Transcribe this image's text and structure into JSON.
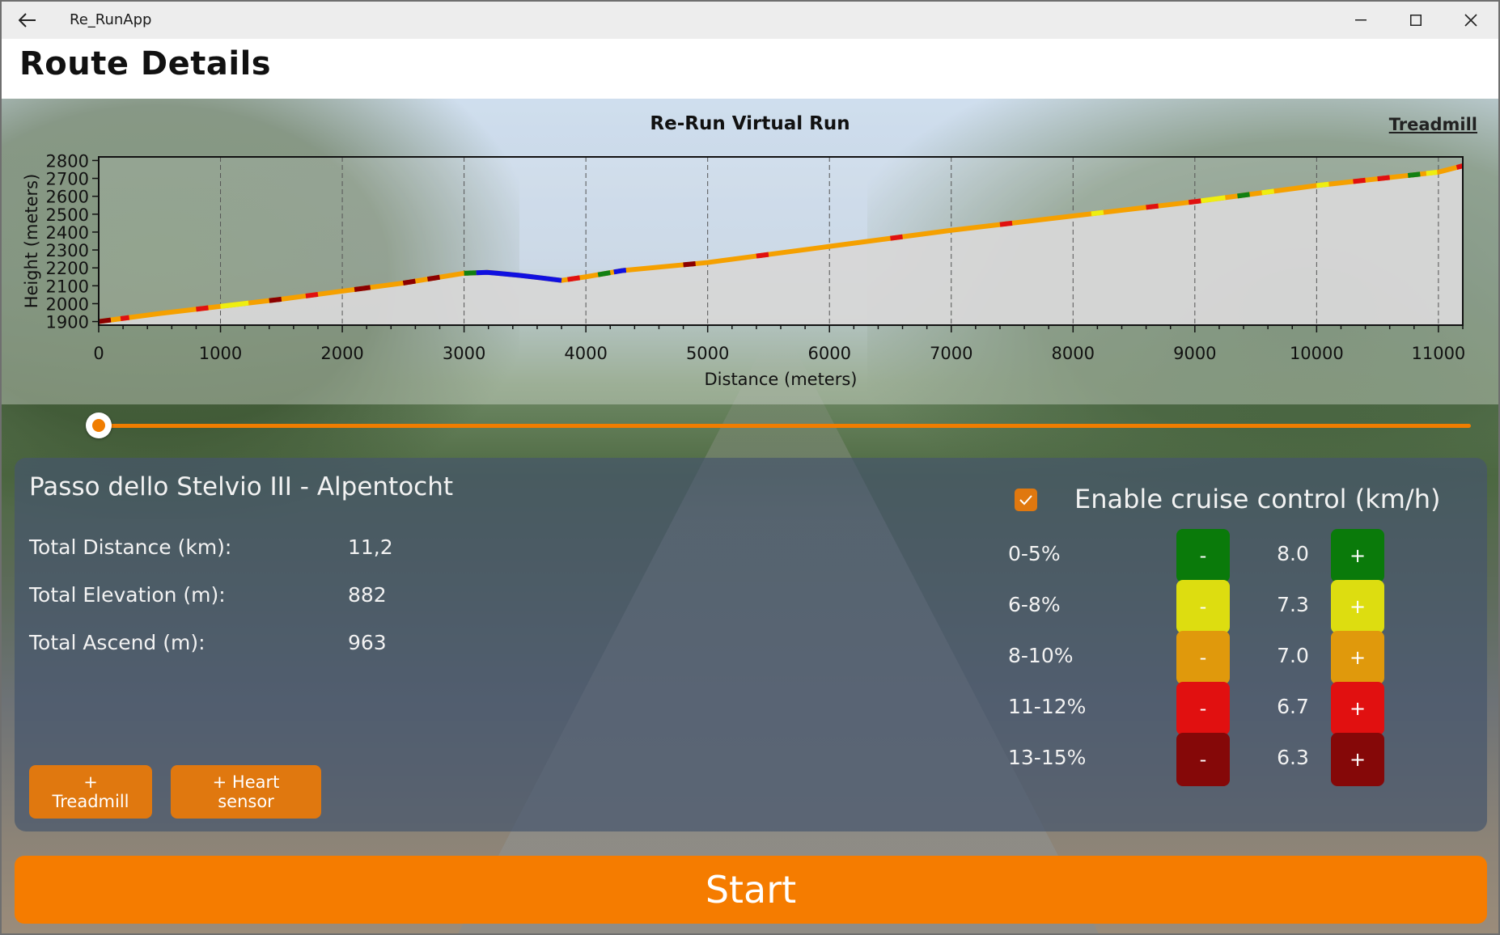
{
  "window": {
    "app_title": "Re_RunApp"
  },
  "page": {
    "title": "Route Details"
  },
  "chart": {
    "treadmill_link": "Treadmill"
  },
  "slider": {
    "position_fraction": 0.0
  },
  "route": {
    "name": "Passo dello Stelvio III - Alpentocht",
    "stats": [
      {
        "label": "Total Distance (km):",
        "value": "11,2"
      },
      {
        "label": "Total Elevation (m):",
        "value": "882"
      },
      {
        "label": "Total Ascend (m):",
        "value": "963"
      }
    ],
    "add_treadmill_label": "+ Treadmill",
    "add_heart_sensor_label": "+ Heart sensor"
  },
  "cruise": {
    "enabled": true,
    "label": "Enable cruise control (km/h)",
    "zones": [
      {
        "label": "0-5%",
        "value": "8.0",
        "color": "#0a7a0a",
        "text": "#ffffff",
        "minus": "-",
        "plus": "+"
      },
      {
        "label": "6-8%",
        "value": "7.3",
        "color": "#dddd10",
        "text": "#ffffff",
        "minus": "-",
        "plus": "+"
      },
      {
        "label": "8-10%",
        "value": "7.0",
        "color": "#e0990c",
        "text": "#ffffff",
        "minus": "-",
        "plus": "+"
      },
      {
        "label": "11-12%",
        "value": "6.7",
        "color": "#e11010",
        "text": "#ffffff",
        "minus": "-",
        "plus": "+"
      },
      {
        "label": "13-15%",
        "value": "6.3",
        "color": "#850808",
        "text": "#ffffff",
        "minus": "-",
        "plus": "+"
      }
    ]
  },
  "start_label": "Start",
  "colors": {
    "accent": "#f57c00",
    "route_orange": "#f5a000",
    "blue": "#1010e0",
    "dark_red": "#8b0000",
    "red": "#e01010",
    "yellow": "#eeee10",
    "green": "#128012"
  },
  "chart_data": {
    "type": "area",
    "title": "Re-Run Virtual Run",
    "xlabel": "Distance (meters)",
    "ylabel": "Height (meters)",
    "xlim": [
      0,
      11200
    ],
    "ylim": [
      1880,
      2820
    ],
    "xticks": [
      0,
      1000,
      2000,
      3000,
      4000,
      5000,
      6000,
      7000,
      8000,
      9000,
      10000,
      11000
    ],
    "yticks": [
      1900,
      2000,
      2100,
      2200,
      2300,
      2400,
      2500,
      2600,
      2700,
      2800
    ],
    "grid": "vertical-dashed",
    "series": [
      {
        "x": [
          0,
          500,
          1000,
          1500,
          2000,
          2500,
          3000,
          3200,
          3500,
          3800,
          4000,
          4300,
          5000,
          6000,
          7000,
          8000,
          9000,
          10000,
          11000,
          11200
        ],
        "y": [
          1900,
          1945,
          1985,
          2025,
          2070,
          2115,
          2170,
          2175,
          2155,
          2130,
          2150,
          2185,
          2230,
          2320,
          2410,
          2490,
          2570,
          2660,
          2735,
          2770
        ]
      }
    ],
    "segments": [
      {
        "from": 0,
        "to": 100,
        "color": "#8b0000"
      },
      {
        "from": 100,
        "to": 180,
        "color": "#f5a000"
      },
      {
        "from": 180,
        "to": 250,
        "color": "#e01010"
      },
      {
        "from": 800,
        "to": 900,
        "color": "#e01010"
      },
      {
        "from": 1000,
        "to": 1230,
        "color": "#eeee10"
      },
      {
        "from": 1400,
        "to": 1500,
        "color": "#8b0000"
      },
      {
        "from": 1700,
        "to": 1800,
        "color": "#e01010"
      },
      {
        "from": 2100,
        "to": 2230,
        "color": "#8b0000"
      },
      {
        "from": 2500,
        "to": 2600,
        "color": "#8b0000"
      },
      {
        "from": 2700,
        "to": 2800,
        "color": "#8b0000"
      },
      {
        "from": 3000,
        "to": 3100,
        "color": "#128012"
      },
      {
        "from": 3100,
        "to": 3800,
        "color": "#1010e0"
      },
      {
        "from": 3850,
        "to": 3950,
        "color": "#e01010"
      },
      {
        "from": 4100,
        "to": 4200,
        "color": "#128012"
      },
      {
        "from": 4230,
        "to": 4330,
        "color": "#1010e0"
      },
      {
        "from": 4800,
        "to": 4900,
        "color": "#8b0000"
      },
      {
        "from": 5400,
        "to": 5500,
        "color": "#e01010"
      },
      {
        "from": 6500,
        "to": 6600,
        "color": "#e01010"
      },
      {
        "from": 7400,
        "to": 7500,
        "color": "#e01010"
      },
      {
        "from": 8150,
        "to": 8250,
        "color": "#eeee10"
      },
      {
        "from": 8600,
        "to": 8700,
        "color": "#e01010"
      },
      {
        "from": 8950,
        "to": 9050,
        "color": "#e01010"
      },
      {
        "from": 9050,
        "to": 9250,
        "color": "#eeee10"
      },
      {
        "from": 9350,
        "to": 9450,
        "color": "#128012"
      },
      {
        "from": 9550,
        "to": 9650,
        "color": "#eeee10"
      },
      {
        "from": 10000,
        "to": 10100,
        "color": "#eeee10"
      },
      {
        "from": 10300,
        "to": 10400,
        "color": "#e01010"
      },
      {
        "from": 10500,
        "to": 10600,
        "color": "#e01010"
      },
      {
        "from": 10750,
        "to": 10850,
        "color": "#128012"
      },
      {
        "from": 10900,
        "to": 10990,
        "color": "#eeee10"
      },
      {
        "from": 11150,
        "to": 11200,
        "color": "#e01010"
      }
    ]
  }
}
